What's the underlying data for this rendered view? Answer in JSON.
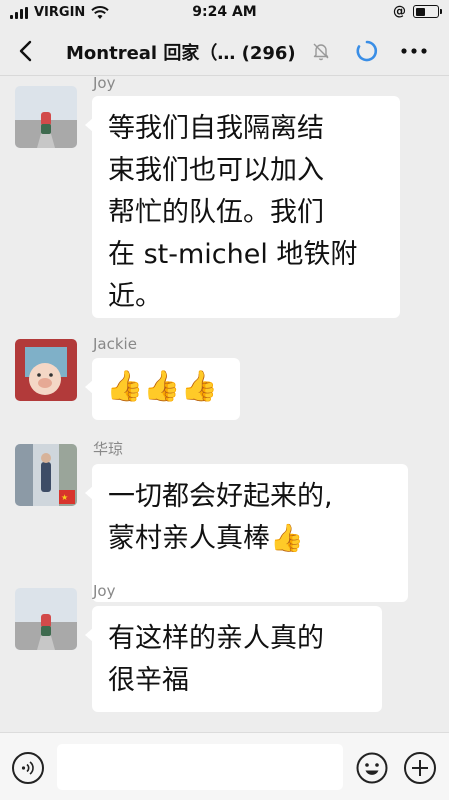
{
  "status_bar": {
    "carrier": "VIRGIN",
    "time": "9:24 AM",
    "lock_symbol": "@"
  },
  "nav": {
    "title": "Montreal 回家（…  (296)",
    "icons": [
      "back-icon",
      "mute-bell-icon",
      "loading-spinner-icon",
      "more-icon"
    ]
  },
  "messages": [
    {
      "sender": "Joy",
      "lines": [
        "等我们自我隔离结",
        "束我们也可以加入",
        "帮忙的队伍。我们",
        "在 st-michel 地铁附",
        "近。"
      ]
    },
    {
      "sender": "Jackie",
      "lines": [
        "👍👍👍"
      ]
    },
    {
      "sender": "华琼",
      "lines": [
        "一切都会好起来的,",
        "蒙村亲人真棒👍"
      ]
    },
    {
      "sender": "Joy",
      "lines": [
        "有这样的亲人真的",
        "很辛福"
      ]
    }
  ],
  "input_bar": {
    "placeholder": "",
    "icons": [
      "voice-icon",
      "emoji-icon",
      "plus-icon"
    ]
  },
  "colors": {
    "background": "#ededed",
    "bubble": "#ffffff",
    "accent_blue": "#3a8ee6"
  }
}
